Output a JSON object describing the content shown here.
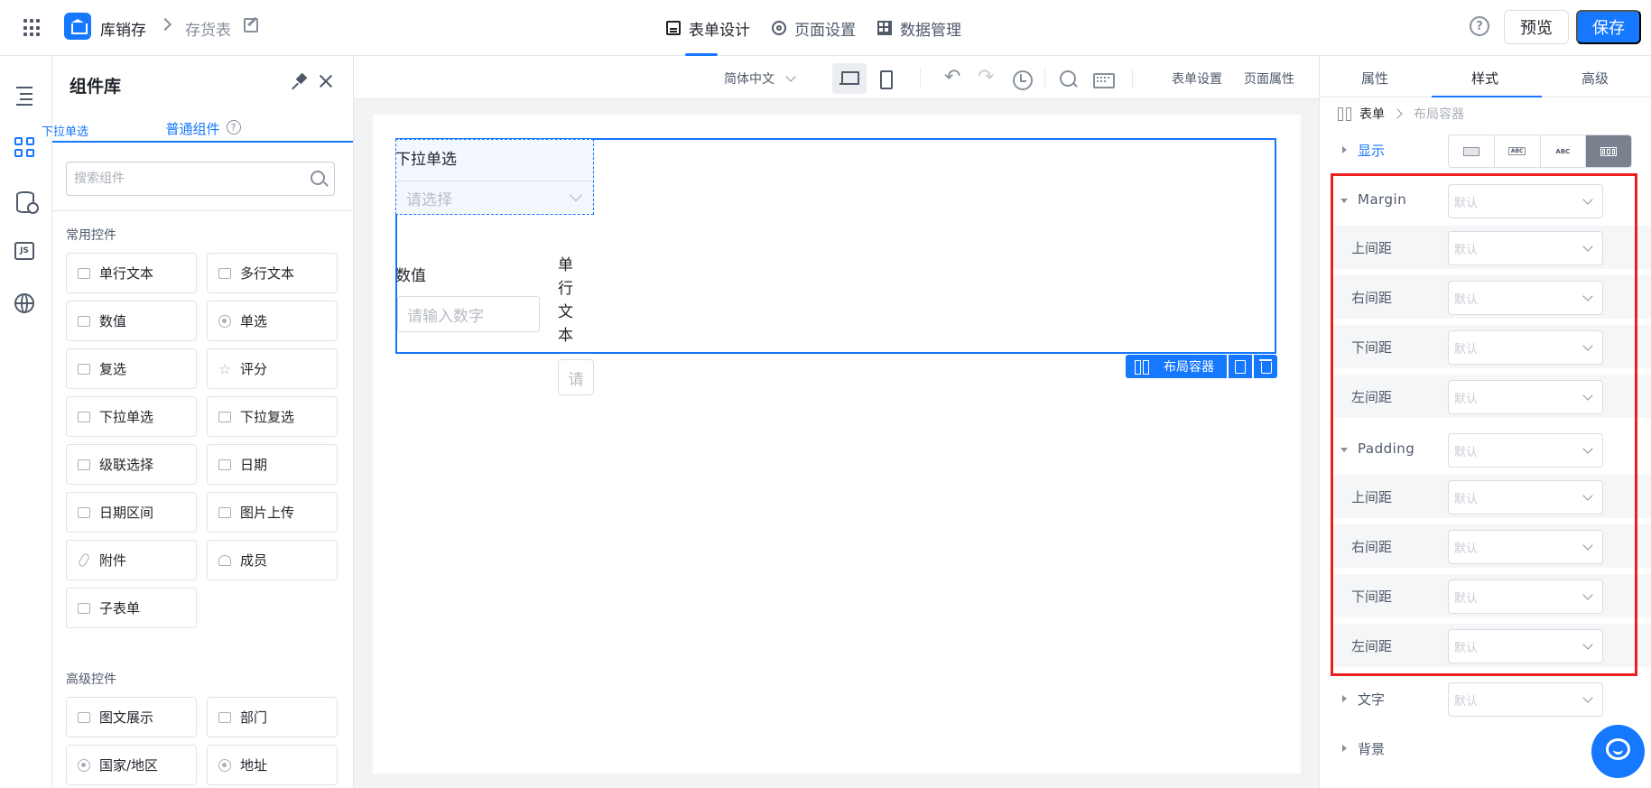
{
  "header": {
    "app_name": "库销存",
    "doc_name": "存货表",
    "tabs": [
      {
        "label": "表单设计"
      },
      {
        "label": "页面设置"
      },
      {
        "label": "数据管理"
      }
    ],
    "help": "?",
    "preview_label": "预览",
    "save_label": "保存"
  },
  "rail": {
    "icons": [
      "outline-icon",
      "components-icon",
      "data-source-icon",
      "js-icon",
      "globe-icon"
    ],
    "js_text": "JS"
  },
  "component_panel": {
    "title": "组件库",
    "tab_label": "普通组件",
    "tab_help": "?",
    "search_placeholder": "搜索组件",
    "groups": [
      {
        "title": "常用控件",
        "items": [
          "单行文本",
          "多行文本",
          "数值",
          "单选",
          "复选",
          "评分",
          "下拉单选",
          "下拉复选",
          "级联选择",
          "日期",
          "日期区间",
          "图片上传",
          "附件",
          "成员",
          "子表单"
        ]
      },
      {
        "title": "高级控件",
        "items": [
          "图文展示",
          "部门",
          "国家/地区",
          "地址"
        ]
      }
    ]
  },
  "canvas_toolbar": {
    "language": "简体中文",
    "form_settings": "表单设置",
    "page_props": "页面属性"
  },
  "canvas": {
    "selected_label": "下拉单选",
    "dropdown_label": "下拉单选",
    "dropdown_placeholder": "请选择",
    "number_label": "数值",
    "number_placeholder": "请输入数字",
    "text_label_vertical": [
      "单",
      "行",
      "文",
      "本"
    ],
    "text_placeholder_short": "请",
    "container_tag": "布局容器"
  },
  "right_panel": {
    "tabs": [
      "属性",
      "样式",
      "高级"
    ],
    "active_tab": "样式",
    "breadcrumb": {
      "root": "表单",
      "current": "布局容器"
    },
    "display_label": "显示",
    "display_modes": [
      "ABC",
      "ABC"
    ],
    "default_value": "默认",
    "margin": {
      "label": "Margin",
      "rows": [
        "上间距",
        "右间距",
        "下间距",
        "左间距"
      ]
    },
    "padding": {
      "label": "Padding",
      "rows": [
        "上间距",
        "右间距",
        "下间距",
        "左间距"
      ]
    },
    "text_label": "文字",
    "background_label": "背景"
  },
  "colors": {
    "accent": "#1677ff",
    "highlight": "#ee1f1f"
  }
}
